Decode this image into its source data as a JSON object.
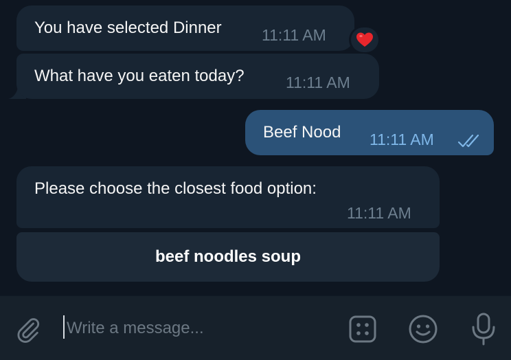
{
  "messages": [
    {
      "direction": "incoming",
      "text": "You have selected Dinner",
      "time": "11:11 AM",
      "reaction": "red-heart"
    },
    {
      "direction": "incoming",
      "text": "What have you eaten today?",
      "time": "11:11 AM"
    },
    {
      "direction": "outgoing",
      "text": "Beef Nood",
      "time": "11:11 AM",
      "status": "read-double-check"
    },
    {
      "direction": "incoming",
      "text": "Please choose the closest food option:",
      "time": "11:11 AM"
    }
  ],
  "inline_keyboard": {
    "buttons": [
      {
        "label": "beef noodles soup"
      }
    ]
  },
  "composer": {
    "placeholder": "Write a message...",
    "value": "",
    "icons": [
      "paperclip-icon",
      "bot-commands-icon",
      "emoji-icon",
      "microphone-icon"
    ]
  },
  "colors": {
    "chat_background": "#0e1621",
    "incoming_bubble": "#182533",
    "outgoing_bubble": "#2b5278",
    "keyboard_button": "#1d2a38",
    "composer_background": "#17212b",
    "timestamp_incoming": "#6d7f8f",
    "timestamp_outgoing": "#7fb7e8",
    "reaction_heart": "#e8262c"
  }
}
